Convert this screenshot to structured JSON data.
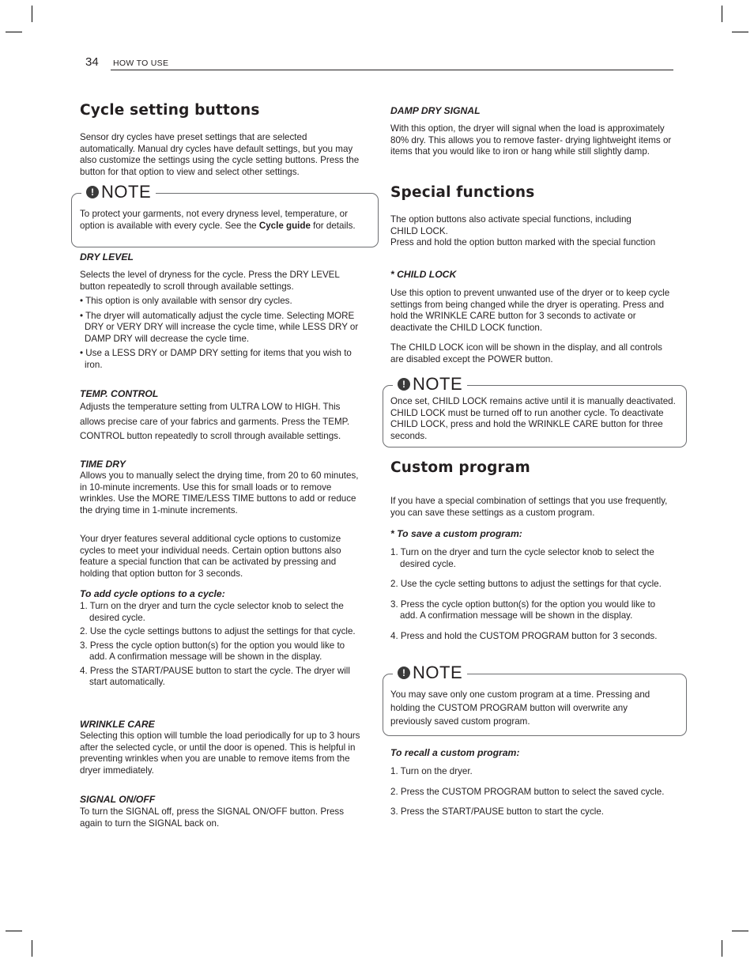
{
  "header": {
    "page_number": "34",
    "section": "HOW TO USE"
  },
  "left": {
    "title": "Cycle setting buttons",
    "intro": "Sensor dry cycles have preset settings that are selected automatically. Manual dry cycles have default settings, but you may also customize the settings using the cycle setting buttons. Press the button for that option to view and select other settings.",
    "note": {
      "label": "NOTE",
      "text_before": "To protect your garments, not every dryness level, temperature, or option is available with every cycle. See the ",
      "bold": "Cycle guide",
      "text_after": " for details."
    },
    "dry_level": {
      "heading": "DRY LEVEL",
      "text": "Selects the level of dryness for the cycle. Press the DRY LEVEL button repeatedly to scroll through available settings.",
      "bullets": [
        "• This option is only available with sensor dry cycles.",
        "• The dryer will automatically adjust the cycle time. Selecting MORE DRY or VERY DRY will increase the cycle time, while LESS DRY or DAMP DRY will decrease the cycle time.",
        "• Use a LESS DRY or DAMP DRY setting for items that you wish to iron."
      ]
    },
    "temp_control": {
      "heading": "TEMP. CONTROL",
      "text": "Adjusts the temperature setting from ULTRA LOW to HIGH. This allows precise care of your fabrics and garments. Press the TEMP. CONTROL button repeatedly to scroll through available settings."
    },
    "time_dry": {
      "heading": "TIME DRY",
      "text": "Allows you to manually select the drying time, from 20 to 60 minutes, in 10-minute increments. Use this for small loads or to remove wrinkles. Use the MORE TIME/LESS TIME buttons to add or reduce the drying time in 1-minute increments."
    },
    "options_intro": "Your dryer features several additional cycle options to customize cycles to meet your individual needs. Certain option buttons also feature a special function that can be activated by pressing and holding that option button for 3 seconds.",
    "add_options": {
      "heading": "To add cycle options to a cycle:",
      "steps": [
        "1. Turn on the dryer and turn the cycle selector knob to select the desired cycle.",
        "2. Use the cycle settings buttons to adjust the settings for that cycle.",
        "3. Press the cycle option button(s) for the option you would like to add. A confirmation message will be shown in the display.",
        "4. Press the START/PAUSE button to start the cycle. The dryer will start automatically."
      ]
    },
    "wrinkle_care": {
      "heading": "WRINKLE CARE",
      "text": "Selecting this option will tumble the load periodically for up to 3 hours after the selected cycle, or until the door is opened. This is helpful in preventing wrinkles when you are unable to remove items from the dryer immediately."
    },
    "signal": {
      "heading": "SIGNAL ON/OFF",
      "text": "To turn the SIGNAL off, press the SIGNAL ON/OFF button. Press again to turn the SIGNAL back on."
    }
  },
  "right": {
    "damp_dry": {
      "heading": "DAMP DRY SIGNAL",
      "text": "With this option, the dryer will signal when the load is approximately 80% dry. This allows you to remove faster- drying lightweight items or items that you would like to iron or hang while still slightly damp."
    },
    "special": {
      "title": "Special functions",
      "text1": "The option buttons also activate special functions, including CHILD LOCK.",
      "text2": "Press and hold the option button marked with the special function"
    },
    "child_lock": {
      "heading": "* CHILD LOCK",
      "text1": "Use this option to prevent unwanted use of the dryer or to keep cycle settings from being changed while the dryer is operating. Press and hold the WRINKLE CARE button for 3 seconds to activate or deactivate the CHILD LOCK function.",
      "text2": "The CHILD LOCK icon will be shown in the display, and all controls are disabled except the POWER button."
    },
    "note1": {
      "label": "NOTE",
      "text": "Once set, CHILD LOCK remains active until it is manually deactivated. CHILD LOCK must be turned off to run another cycle. To deactivate CHILD LOCK, press and hold the WRINKLE CARE button for three seconds."
    },
    "custom": {
      "title": "Custom program",
      "intro": "If you have a special combination of settings that you use frequently, you can save these settings as a custom program.",
      "save_heading": "* To save a custom program:",
      "save_steps": [
        "1. Turn on the dryer and turn the cycle selector knob to select the desired cycle.",
        "2. Use the cycle setting buttons to adjust the settings for that cycle.",
        "3. Press the cycle option button(s) for the option you would like to add. A confirmation message will be shown in the display.",
        "4. Press and hold the CUSTOM PROGRAM button for 3 seconds."
      ]
    },
    "note2": {
      "label": "NOTE",
      "text": "You may save only one custom  program at a time. Pressing and holding the CUSTOM PROGRAM button will overwrite any previously saved custom program."
    },
    "recall": {
      "heading": "To recall a custom program:",
      "steps": [
        "1. Turn on the dryer.",
        "2. Press the CUSTOM PROGRAM button to select the saved cycle.",
        "3. Press the START/PAUSE button to start the cycle."
      ]
    }
  }
}
